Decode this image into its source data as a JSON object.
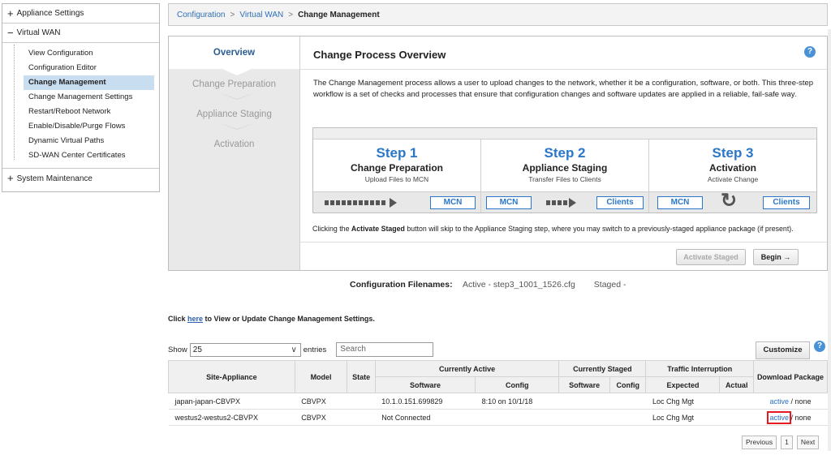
{
  "tree": {
    "appliance_settings": "Appliance Settings",
    "virtual_wan": "Virtual WAN",
    "children": [
      "View Configuration",
      "Configuration Editor",
      "Change Management",
      "Change Management Settings",
      "Restart/Reboot Network",
      "Enable/Disable/Purge Flows",
      "Dynamic Virtual Paths",
      "SD-WAN Center Certificates"
    ],
    "selected_index": 2,
    "system_maintenance": "System Maintenance",
    "plus": "+",
    "minus": "−"
  },
  "breadcrumb": {
    "items": [
      "Configuration",
      "Virtual WAN"
    ],
    "current": "Change Management",
    "sep": ">"
  },
  "wizard": {
    "steps": [
      "Overview",
      "Change Preparation",
      "Appliance Staging",
      "Activation"
    ],
    "active_step": 0,
    "title": "Change Process Overview",
    "help": "?",
    "description": "The Change Management process allows a user to upload changes to the network, whether it be a configuration, software, or both. This three-step workflow is a set of checks and processes that ensure that configuration changes and software updates are applied in a reliable, fail-safe way.",
    "process": [
      {
        "step": "Step 1",
        "name": "Change Preparation",
        "sub": "Upload Files to MCN",
        "tags": [
          "MCN"
        ]
      },
      {
        "step": "Step 2",
        "name": "Appliance Staging",
        "sub": "Transfer Files to Clients",
        "tags": [
          "MCN",
          "Clients"
        ]
      },
      {
        "step": "Step 3",
        "name": "Activation",
        "sub": "Activate Change",
        "tags": [
          "MCN",
          "Clients"
        ]
      }
    ],
    "note_prefix": "Clicking the ",
    "note_bold": "Activate Staged",
    "note_suffix": " button will skip to the Appliance Staging step, where you may switch to a previously-staged appliance package (if present).",
    "activate_label": "Activate Staged",
    "begin_label": "Begin →",
    "reactivate_icon": "↻"
  },
  "config_files": {
    "label": "Configuration Filenames:",
    "active": "Active - step3_1001_1526.cfg",
    "staged": "Staged -"
  },
  "settings_link": {
    "prefix": "Click ",
    "link": "here",
    "suffix": " to View or Update Change Management Settings."
  },
  "table_controls": {
    "show": "Show",
    "page_size": "25",
    "entries": "entries",
    "search_placeholder": "Search",
    "customize": "Customize",
    "help": "?"
  },
  "table": {
    "headers": {
      "site_appliance": "Site-Appliance",
      "model": "Model",
      "state": "State",
      "currently_active": "Currently Active",
      "currently_staged": "Currently Staged",
      "traffic_interruption": "Traffic Interruption",
      "download_package": "Download Package",
      "software": "Software",
      "config": "Config",
      "expected": "Expected",
      "actual": "Actual"
    },
    "rows": [
      {
        "site": "japan-japan-CBVPX",
        "model": "CBVPX",
        "state": "",
        "active_sw": "10.1.0.151.699829",
        "active_cfg": "8:10 on 10/1/18",
        "staged_sw": "",
        "staged_cfg": "",
        "expected": "Loc Chg Mgt",
        "actual": "",
        "dl_link": "active",
        "dl_rest": " / none"
      },
      {
        "site": "westus2-westus2-CBVPX",
        "model": "CBVPX",
        "state": "",
        "active_sw": "Not Connected",
        "active_cfg": "",
        "staged_sw": "",
        "staged_cfg": "",
        "expected": "Loc Chg Mgt",
        "actual": "",
        "dl_link": "active",
        "dl_rest": " / none"
      }
    ]
  },
  "pager": {
    "previous": "Previous",
    "page": "1",
    "next": "Next"
  },
  "colors": {
    "accent": "#2a77c9",
    "selection": "#c9ddf1",
    "highlight": "#e31b23"
  }
}
